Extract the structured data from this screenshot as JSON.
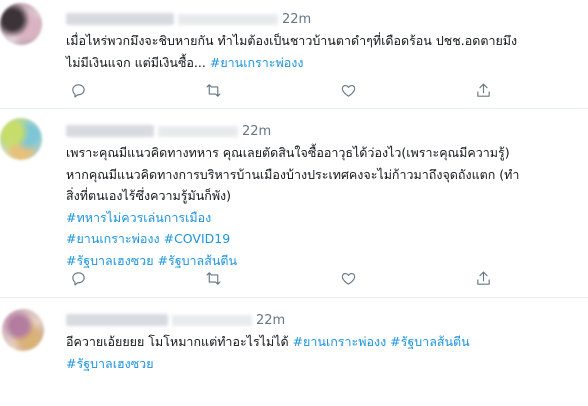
{
  "tweets": [
    {
      "time": "22m",
      "text_line1": "เมื่อไหร่พวกมึงจะชิบหายกัน ทำไมต้องเป็นชาวบ้านตาดำๆที่เดือดร้อน ปชช.อดตายมึง",
      "text_line2": "ไม่มีเงินแจก แต่มีเงินซื้อ... ",
      "hashtag1": "#ยานเกราะพ่องง"
    },
    {
      "time": "22m",
      "text_line1": "เพราะคุณมีแนวคิดทางทหาร คุณเลยตัดสินใจซื้ออาวุธได้ว่องไว(เพราะคุณมีความรู้)",
      "text_line2": "หากคุณมีแนวคิดทางการบริหารบ้านเมืองบ้างประเทศคงจะไม่ก้าวมาถึงจุดถังแตก (ทำ",
      "text_line3": "สิ่งที่ตนเองไร้ซึ่งความรู้มันก็พัง)",
      "hashtag1": "#ทหารไม่ควรเล่นการเมือง",
      "hashtag2": "#ยานเกราะพ่องง",
      "hashtag3": "#COVID19",
      "hashtag4": "#รัฐบาลเฮงซวย",
      "hashtag5": "#รัฐบาลส้นตีน"
    },
    {
      "time": "22m",
      "text_line1": "อีควายเอ้ยยยย โมโหมากแต่ทำอะไรไม่ได้ ",
      "hashtag1": "#ยานเกราะพ่องง",
      "hashtag2": "#รัฐบาลส้นตีน",
      "hashtag3": "#รัฐบาลเฮงซวย"
    }
  ],
  "colors": {
    "hashtag": "#1b95e0",
    "meta": "#657786",
    "divider": "#e6ecf0"
  },
  "icons": [
    "reply-icon",
    "retweet-icon",
    "like-icon",
    "share-icon"
  ]
}
